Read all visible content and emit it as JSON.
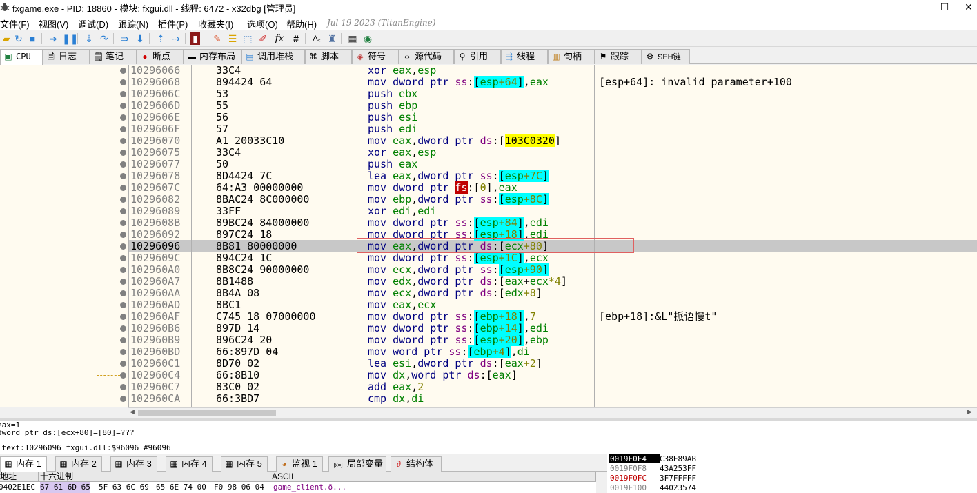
{
  "window": {
    "title": "fxgame.exe - PID: 18860 - 模块: fxgui.dll - 线程: 6472 - x32dbg [管理员]",
    "minimize": "—",
    "maximize": "☐",
    "close": "✕"
  },
  "menu": {
    "items": [
      "文件(F)",
      "视图(V)",
      "调试(D)",
      "跟踪(N)",
      "插件(P)",
      "收藏夹(I)",
      "选项(O)",
      "帮助(H)"
    ],
    "version": "Jul 19 2023 (TitanEngine)"
  },
  "toolbar": {
    "icons": [
      "open-icon",
      "restart-icon",
      "stop-icon",
      "run-icon",
      "pause-icon",
      "step-into-icon",
      "step-over-icon",
      "trace-into-icon",
      "trace-over-icon",
      "execute-till-return-icon",
      "execute-till-user-code-icon",
      "scylla-icon",
      "comment-icon",
      "label-icon",
      "bookmark-icon",
      "function-icon",
      "fx-icon",
      "hash-icon",
      "font-icon",
      "patch-icon",
      "calculator-icon",
      "globe-icon"
    ]
  },
  "tabs": [
    {
      "label": "CPU",
      "icon": "cpu-icon",
      "active": true
    },
    {
      "label": "日志",
      "icon": "log-icon"
    },
    {
      "label": "笔记",
      "icon": "notes-icon"
    },
    {
      "label": "断点",
      "icon": "breakpoint-icon"
    },
    {
      "label": "内存布局",
      "icon": "memory-map-icon"
    },
    {
      "label": "调用堆栈",
      "icon": "call-stack-icon"
    },
    {
      "label": "脚本",
      "icon": "script-icon"
    },
    {
      "label": "符号",
      "icon": "symbol-icon"
    },
    {
      "label": "源代码",
      "icon": "source-icon"
    },
    {
      "label": "引用",
      "icon": "references-icon"
    },
    {
      "label": "线程",
      "icon": "threads-icon"
    },
    {
      "label": "句柄",
      "icon": "handles-icon"
    },
    {
      "label": "跟踪",
      "icon": "trace-icon"
    },
    {
      "label": "SEH链",
      "icon": "seh-chain-icon"
    }
  ],
  "disasm": [
    {
      "addr": "10296066",
      "bytes": "33C4",
      "ins": [
        [
          "k",
          "xor "
        ],
        [
          "r",
          "eax"
        ],
        [
          "t",
          ","
        ],
        [
          "r",
          "esp"
        ]
      ],
      "cmt": ""
    },
    {
      "addr": "10296068",
      "bytes": "894424 64",
      "ins": [
        [
          "k",
          "mov "
        ],
        [
          "k",
          "dword ptr "
        ],
        [
          "s",
          "ss"
        ],
        [
          "t",
          ":"
        ],
        [
          "c",
          "["
        ],
        [
          "rc",
          "esp"
        ],
        [
          "nc",
          "+64"
        ],
        [
          "c",
          "]"
        ],
        [
          "t",
          ","
        ],
        [
          "r",
          "eax"
        ]
      ],
      "cmt": "[esp+64]:_invalid_parameter+100"
    },
    {
      "addr": "1029606C",
      "bytes": "53",
      "ins": [
        [
          "k",
          "push "
        ],
        [
          "r",
          "ebx"
        ]
      ],
      "cmt": ""
    },
    {
      "addr": "1029606D",
      "bytes": "55",
      "ins": [
        [
          "k",
          "push "
        ],
        [
          "r",
          "ebp"
        ]
      ],
      "cmt": ""
    },
    {
      "addr": "1029606E",
      "bytes": "56",
      "ins": [
        [
          "k",
          "push "
        ],
        [
          "r",
          "esi"
        ]
      ],
      "cmt": ""
    },
    {
      "addr": "1029606F",
      "bytes": "57",
      "ins": [
        [
          "k",
          "push "
        ],
        [
          "r",
          "edi"
        ]
      ],
      "cmt": ""
    },
    {
      "addr": "10296070",
      "bytes": "A1 20033C10",
      "bytes_ul": true,
      "ins": [
        [
          "k",
          "mov "
        ],
        [
          "r",
          "eax"
        ],
        [
          "t",
          ","
        ],
        [
          "k",
          "dword ptr "
        ],
        [
          "s",
          "ds"
        ],
        [
          "t",
          ":["
        ],
        [
          "y",
          "103C0320"
        ],
        [
          "t",
          "]"
        ]
      ],
      "cmt": ""
    },
    {
      "addr": "10296075",
      "bytes": "33C4",
      "ins": [
        [
          "k",
          "xor "
        ],
        [
          "r",
          "eax"
        ],
        [
          "t",
          ","
        ],
        [
          "r",
          "esp"
        ]
      ],
      "cmt": ""
    },
    {
      "addr": "10296077",
      "bytes": "50",
      "ins": [
        [
          "k",
          "push "
        ],
        [
          "r",
          "eax"
        ]
      ],
      "cmt": ""
    },
    {
      "addr": "10296078",
      "bytes": "8D4424 7C",
      "ins": [
        [
          "k",
          "lea "
        ],
        [
          "r",
          "eax"
        ],
        [
          "t",
          ","
        ],
        [
          "k",
          "dword ptr "
        ],
        [
          "s",
          "ss"
        ],
        [
          "t",
          ":"
        ],
        [
          "c",
          "["
        ],
        [
          "rc",
          "esp"
        ],
        [
          "nc",
          "+7C"
        ],
        [
          "c",
          "]"
        ]
      ],
      "cmt": ""
    },
    {
      "addr": "1029607C",
      "bytes": "64:A3 00000000",
      "ins": [
        [
          "k",
          "mov "
        ],
        [
          "k",
          "dword ptr "
        ],
        [
          "red",
          "fs"
        ],
        [
          "t",
          ":["
        ],
        [
          "n",
          "0"
        ],
        [
          "t",
          "],"
        ],
        [
          "r",
          "eax"
        ]
      ],
      "cmt": ""
    },
    {
      "addr": "10296082",
      "bytes": "8BAC24 8C000000",
      "ins": [
        [
          "k",
          "mov "
        ],
        [
          "r",
          "ebp"
        ],
        [
          "t",
          ","
        ],
        [
          "k",
          "dword ptr "
        ],
        [
          "s",
          "ss"
        ],
        [
          "t",
          ":"
        ],
        [
          "c",
          "["
        ],
        [
          "rc",
          "esp"
        ],
        [
          "nc",
          "+8C"
        ],
        [
          "c",
          "]"
        ]
      ],
      "cmt": ""
    },
    {
      "addr": "10296089",
      "bytes": "33FF",
      "ins": [
        [
          "k",
          "xor "
        ],
        [
          "r",
          "edi"
        ],
        [
          "t",
          ","
        ],
        [
          "r",
          "edi"
        ]
      ],
      "cmt": ""
    },
    {
      "addr": "1029608B",
      "bytes": "89BC24 84000000",
      "ins": [
        [
          "k",
          "mov "
        ],
        [
          "k",
          "dword ptr "
        ],
        [
          "s",
          "ss"
        ],
        [
          "t",
          ":"
        ],
        [
          "c",
          "["
        ],
        [
          "rc",
          "esp"
        ],
        [
          "nc",
          "+84"
        ],
        [
          "c",
          "]"
        ],
        [
          "t",
          ","
        ],
        [
          "r",
          "edi"
        ]
      ],
      "cmt": ""
    },
    {
      "addr": "10296092",
      "bytes": "897C24 18",
      "ins": [
        [
          "k",
          "mov "
        ],
        [
          "k",
          "dword ptr "
        ],
        [
          "s",
          "ss"
        ],
        [
          "t",
          ":"
        ],
        [
          "c",
          "["
        ],
        [
          "rc",
          "esp"
        ],
        [
          "nc",
          "+18"
        ],
        [
          "c",
          "]"
        ],
        [
          "t",
          ","
        ],
        [
          "r",
          "edi"
        ]
      ],
      "cmt": ""
    },
    {
      "addr": "10296096",
      "bytes": "8B81 80000000",
      "cur": true,
      "ins": [
        [
          "k",
          "mov "
        ],
        [
          "r",
          "eax"
        ],
        [
          "t",
          ","
        ],
        [
          "k",
          "dword ptr "
        ],
        [
          "s",
          "ds"
        ],
        [
          "t",
          ":["
        ],
        [
          "r",
          "ecx"
        ],
        [
          "n",
          "+80"
        ],
        [
          "t",
          "]"
        ]
      ],
      "cmt": ""
    },
    {
      "addr": "1029609C",
      "bytes": "894C24 1C",
      "ins": [
        [
          "k",
          "mov "
        ],
        [
          "k",
          "dword ptr "
        ],
        [
          "s",
          "ss"
        ],
        [
          "t",
          ":"
        ],
        [
          "c",
          "["
        ],
        [
          "rc",
          "esp"
        ],
        [
          "nc",
          "+1C"
        ],
        [
          "c",
          "]"
        ],
        [
          "t",
          ","
        ],
        [
          "r",
          "ecx"
        ]
      ],
      "cmt": ""
    },
    {
      "addr": "102960A0",
      "bytes": "8B8C24 90000000",
      "ins": [
        [
          "k",
          "mov "
        ],
        [
          "r",
          "ecx"
        ],
        [
          "t",
          ","
        ],
        [
          "k",
          "dword ptr "
        ],
        [
          "s",
          "ss"
        ],
        [
          "t",
          ":"
        ],
        [
          "c",
          "["
        ],
        [
          "rc",
          "esp"
        ],
        [
          "nc",
          "+90"
        ],
        [
          "c",
          "]"
        ]
      ],
      "cmt": ""
    },
    {
      "addr": "102960A7",
      "bytes": "8B1488",
      "ins": [
        [
          "k",
          "mov "
        ],
        [
          "r",
          "edx"
        ],
        [
          "t",
          ","
        ],
        [
          "k",
          "dword ptr "
        ],
        [
          "s",
          "ds"
        ],
        [
          "t",
          ":["
        ],
        [
          "r",
          "eax"
        ],
        [
          "t",
          "+"
        ],
        [
          "r",
          "ecx"
        ],
        [
          "n",
          "*4"
        ],
        [
          "t",
          "]"
        ]
      ],
      "cmt": ""
    },
    {
      "addr": "102960AA",
      "bytes": "8B4A 08",
      "ins": [
        [
          "k",
          "mov "
        ],
        [
          "r",
          "ecx"
        ],
        [
          "t",
          ","
        ],
        [
          "k",
          "dword ptr "
        ],
        [
          "s",
          "ds"
        ],
        [
          "t",
          ":["
        ],
        [
          "r",
          "edx"
        ],
        [
          "n",
          "+8"
        ],
        [
          "t",
          "]"
        ]
      ],
      "cmt": ""
    },
    {
      "addr": "102960AD",
      "bytes": "8BC1",
      "ins": [
        [
          "k",
          "mov "
        ],
        [
          "r",
          "eax"
        ],
        [
          "t",
          ","
        ],
        [
          "r",
          "ecx"
        ]
      ],
      "cmt": ""
    },
    {
      "addr": "102960AF",
      "bytes": "C745 18 07000000",
      "ins": [
        [
          "k",
          "mov "
        ],
        [
          "k",
          "dword ptr "
        ],
        [
          "s",
          "ss"
        ],
        [
          "t",
          ":"
        ],
        [
          "c",
          "["
        ],
        [
          "rc",
          "ebp"
        ],
        [
          "nc",
          "+18"
        ],
        [
          "c",
          "]"
        ],
        [
          "t",
          ","
        ],
        [
          "n",
          "7"
        ]
      ],
      "cmt": "[ebp+18]:&L\"挀语慢t\""
    },
    {
      "addr": "102960B6",
      "bytes": "897D 14",
      "ins": [
        [
          "k",
          "mov "
        ],
        [
          "k",
          "dword ptr "
        ],
        [
          "s",
          "ss"
        ],
        [
          "t",
          ":"
        ],
        [
          "c",
          "["
        ],
        [
          "rc",
          "ebp"
        ],
        [
          "nc",
          "+14"
        ],
        [
          "c",
          "]"
        ],
        [
          "t",
          ","
        ],
        [
          "r",
          "edi"
        ]
      ],
      "cmt": ""
    },
    {
      "addr": "102960B9",
      "bytes": "896C24 20",
      "ins": [
        [
          "k",
          "mov "
        ],
        [
          "k",
          "dword ptr "
        ],
        [
          "s",
          "ss"
        ],
        [
          "t",
          ":"
        ],
        [
          "c",
          "["
        ],
        [
          "rc",
          "esp"
        ],
        [
          "nc",
          "+20"
        ],
        [
          "c",
          "]"
        ],
        [
          "t",
          ","
        ],
        [
          "r",
          "ebp"
        ]
      ],
      "cmt": ""
    },
    {
      "addr": "102960BD",
      "bytes": "66:897D 04",
      "ins": [
        [
          "k",
          "mov "
        ],
        [
          "k",
          "word ptr "
        ],
        [
          "s",
          "ss"
        ],
        [
          "t",
          ":"
        ],
        [
          "c",
          "["
        ],
        [
          "rc",
          "ebp"
        ],
        [
          "nc",
          "+4"
        ],
        [
          "c",
          "]"
        ],
        [
          "t",
          ","
        ],
        [
          "r",
          "di"
        ]
      ],
      "cmt": ""
    },
    {
      "addr": "102960C1",
      "bytes": "8D70 02",
      "ins": [
        [
          "k",
          "lea "
        ],
        [
          "r",
          "esi"
        ],
        [
          "t",
          ","
        ],
        [
          "k",
          "dword ptr "
        ],
        [
          "s",
          "ds"
        ],
        [
          "t",
          ":["
        ],
        [
          "r",
          "eax"
        ],
        [
          "n",
          "+2"
        ],
        [
          "t",
          "]"
        ]
      ],
      "cmt": ""
    },
    {
      "addr": "102960C4",
      "bytes": "66:8B10",
      "ins": [
        [
          "k",
          "mov "
        ],
        [
          "r",
          "dx"
        ],
        [
          "t",
          ","
        ],
        [
          "k",
          "word ptr "
        ],
        [
          "s",
          "ds"
        ],
        [
          "t",
          ":["
        ],
        [
          "r",
          "eax"
        ],
        [
          "t",
          "]"
        ]
      ],
      "cmt": ""
    },
    {
      "addr": "102960C7",
      "bytes": "83C0 02",
      "ins": [
        [
          "k",
          "add "
        ],
        [
          "r",
          "eax"
        ],
        [
          "t",
          ","
        ],
        [
          "n",
          "2"
        ]
      ],
      "cmt": ""
    },
    {
      "addr": "102960CA",
      "bytes": "66:3BD7",
      "ins": [
        [
          "k",
          "cmp "
        ],
        [
          "r",
          "dx"
        ],
        [
          "t",
          ","
        ],
        [
          "r",
          "di"
        ]
      ],
      "cmt": ""
    }
  ],
  "info": {
    "line1": "eax=1",
    "line2": "dword ptr ds:[ecx+80]=[80]=???",
    "status": ".text:10296096 fxgui.dll:$96096 #96096"
  },
  "bottom_tabs": [
    {
      "label": "内存 1",
      "icon": "dump-icon",
      "active": true
    },
    {
      "label": "内存 2",
      "icon": "dump-icon"
    },
    {
      "label": "内存 3",
      "icon": "dump-icon"
    },
    {
      "label": "内存 4",
      "icon": "dump-icon"
    },
    {
      "label": "内存 5",
      "icon": "dump-icon"
    },
    {
      "label": "监视 1",
      "icon": "watch-icon"
    },
    {
      "label": "局部变量",
      "icon": "locals-icon",
      "prefix": "[x=]"
    },
    {
      "label": "结构体",
      "icon": "struct-icon"
    }
  ],
  "dump": {
    "headers": [
      "地址",
      "十六进制",
      "ASCII"
    ],
    "row": {
      "addr": "0402E1EC",
      "hex1": "67 61 6D 65",
      "hex2": "5F 63 6C 69",
      "hex3": "65 6E 74 00",
      "hex4": "F0 98 06 04",
      "ascii": "game_client.ð..."
    }
  },
  "stack": [
    {
      "addr": "0019F0F4",
      "val": "C38E89AB",
      "style": "cur"
    },
    {
      "addr": "0019F0F8",
      "val": "43A253FF",
      "style": "gray"
    },
    {
      "addr": "0019F0FC",
      "val": "3F7FFFFF",
      "style": "red"
    },
    {
      "addr": "0019F100",
      "val": "44023574",
      "style": "gray"
    }
  ]
}
